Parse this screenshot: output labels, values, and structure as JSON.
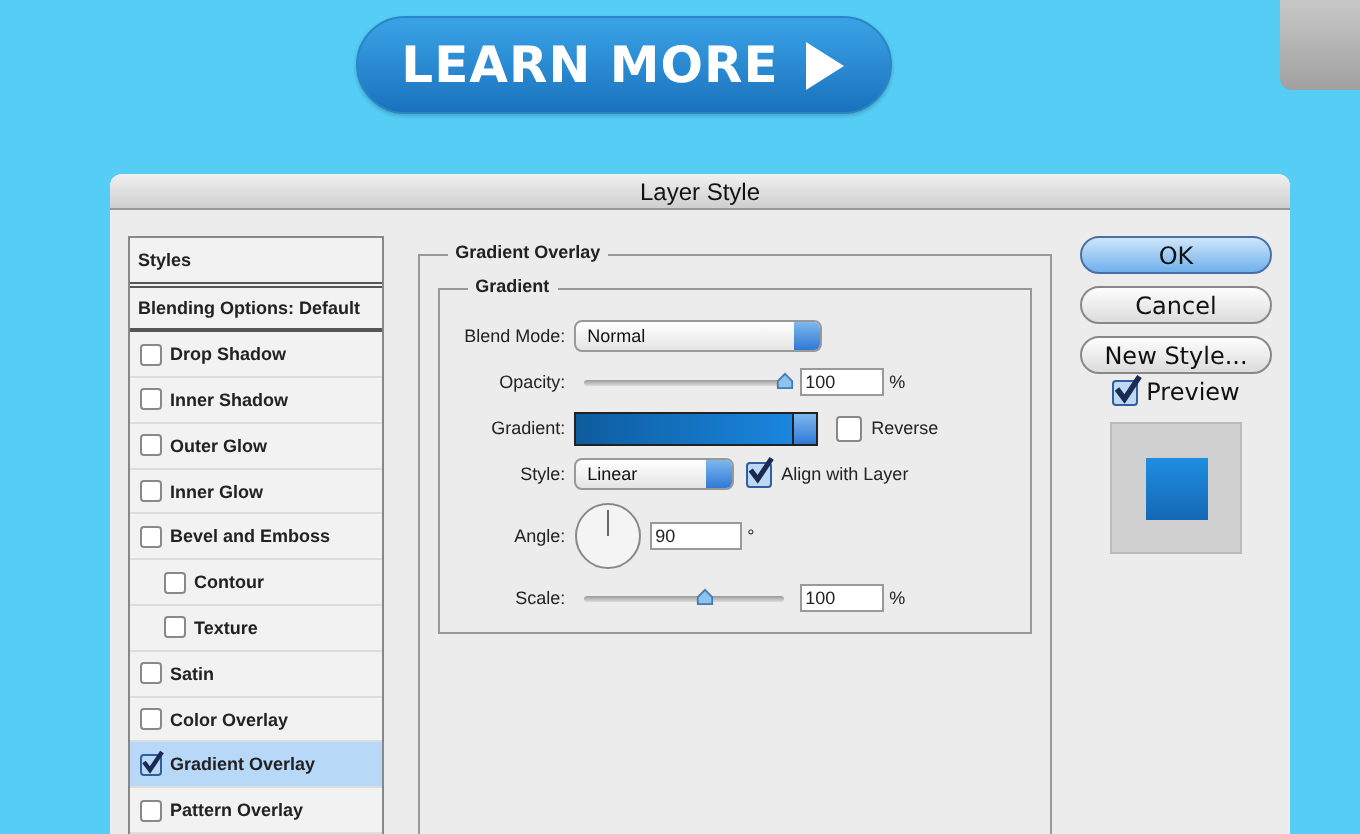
{
  "banner_button": {
    "label": "LEARN MORE"
  },
  "dialog": {
    "title": "Layer Style"
  },
  "styles_list": {
    "header": "Styles",
    "blending": "Blending Options: Default",
    "items": [
      {
        "label": "Drop Shadow",
        "checked": false,
        "selected": false
      },
      {
        "label": "Inner Shadow",
        "checked": false,
        "selected": false
      },
      {
        "label": "Outer Glow",
        "checked": false,
        "selected": false
      },
      {
        "label": "Inner Glow",
        "checked": false,
        "selected": false
      },
      {
        "label": "Bevel and Emboss",
        "checked": false,
        "selected": false,
        "children": [
          {
            "label": "Contour",
            "checked": false,
            "selected": false
          },
          {
            "label": "Texture",
            "checked": false,
            "selected": false
          }
        ]
      },
      {
        "label": "Satin",
        "checked": false,
        "selected": false
      },
      {
        "label": "Color Overlay",
        "checked": false,
        "selected": false
      },
      {
        "label": "Gradient Overlay",
        "checked": true,
        "selected": true
      },
      {
        "label": "Pattern Overlay",
        "checked": false,
        "selected": false
      }
    ]
  },
  "panel": {
    "title": "Gradient Overlay",
    "group_title": "Gradient",
    "blend_mode": {
      "label": "Blend Mode:",
      "value": "Normal"
    },
    "opacity": {
      "label": "Opacity:",
      "level": 1,
      "value": "100",
      "unit": "%"
    },
    "gradient": {
      "label": "Gradient:",
      "reverse": {
        "label": "Reverse",
        "checked": false
      }
    },
    "style": {
      "label": "Style:",
      "value": "Linear",
      "align": {
        "label": "Align with Layer",
        "checked": true
      }
    },
    "angle": {
      "label": "Angle:",
      "value": "90",
      "unit": "°"
    },
    "scale": {
      "label": "Scale:",
      "level": 0.6,
      "value": "100",
      "unit": "%"
    }
  },
  "buttons": [
    {
      "label": "OK",
      "default": true
    },
    {
      "label": "Cancel",
      "default": false
    },
    {
      "label": "New Style...",
      "default": false
    }
  ],
  "preview": {
    "label": "Preview",
    "checked": true
  }
}
